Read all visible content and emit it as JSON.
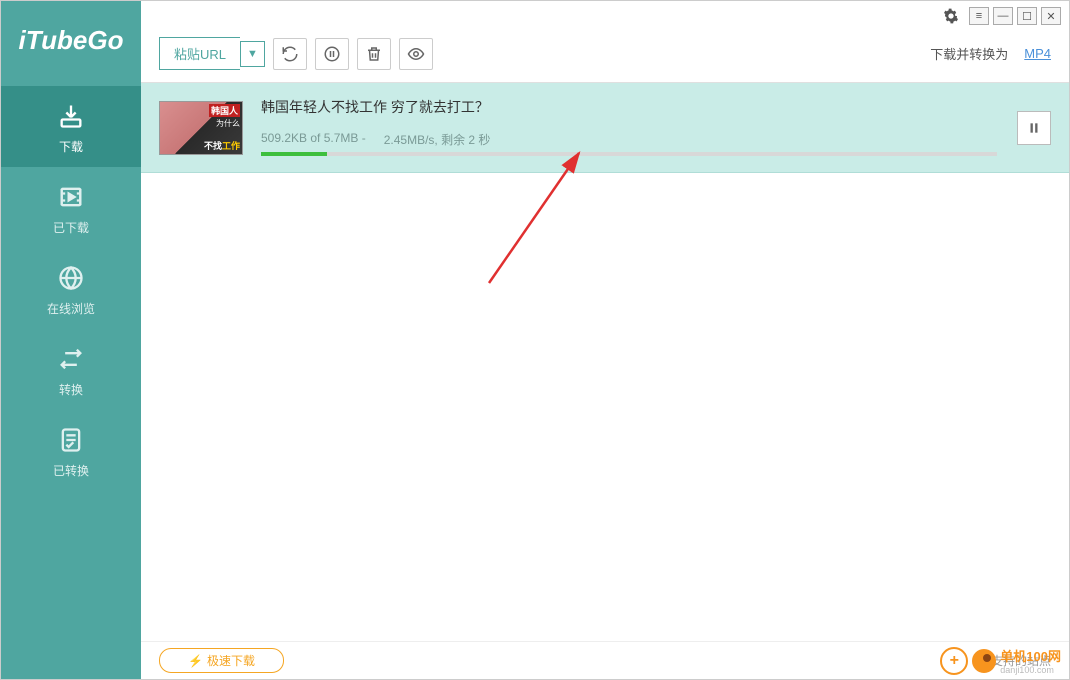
{
  "brand": "iTubeGo",
  "sidebar": {
    "items": [
      {
        "label": "下载",
        "active": true
      },
      {
        "label": "已下载",
        "active": false
      },
      {
        "label": "在线浏览",
        "active": false
      },
      {
        "label": "转换",
        "active": false
      },
      {
        "label": "已转换",
        "active": false
      }
    ]
  },
  "toolbar": {
    "paste_label": "粘贴URL",
    "convert_text": "下载并转换为",
    "convert_format": "MP4"
  },
  "download": {
    "title": "韩国年轻人不找工作 穷了就去打工？",
    "thumb_line1": "韩国人",
    "thumb_line2": "为什么",
    "thumb_line3_pre": "不找",
    "thumb_line3_accent": "工作",
    "progress_text": "509.2KB of 5.7MB -",
    "speed_text": "2.45MB/s, 剩余 2 秒",
    "progress_percent": 9
  },
  "footer": {
    "speed_label": "极速下载",
    "support_label": "支持的站点"
  },
  "watermark": {
    "text": "单机100网",
    "sub": "danji100.com"
  }
}
